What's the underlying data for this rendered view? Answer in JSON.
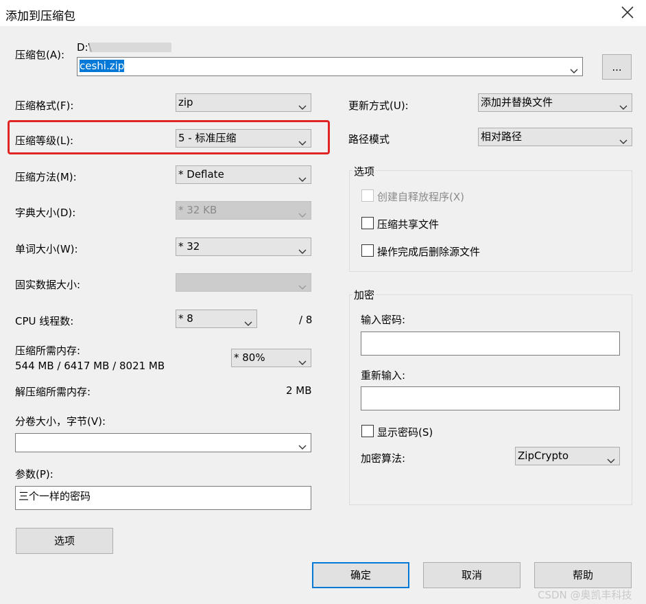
{
  "window": {
    "title": "添加到压缩包",
    "close_icon": "close-icon"
  },
  "archive": {
    "label": "压缩包(A):",
    "path_prefix": "D:\\",
    "filename": "ceshi.zip",
    "browse_label": "..."
  },
  "left": {
    "format": {
      "label": "压缩格式(F):",
      "value": "zip"
    },
    "level": {
      "label": "压缩等级(L):",
      "value": "5 - 标准压缩"
    },
    "method": {
      "label": "压缩方法(M):",
      "value": "*  Deflate"
    },
    "dict": {
      "label": "字典大小(D):",
      "value": "*  32 KB"
    },
    "word": {
      "label": "单词大小(W):",
      "value": "*  32"
    },
    "solid": {
      "label": "固实数据大小:",
      "value": ""
    },
    "cpu": {
      "label": "CPU 线程数:",
      "value": "* 8",
      "max": "/ 8"
    },
    "mem_compress": {
      "label": "压缩所需内存:",
      "value": "544 MB / 6417 MB / 8021 MB",
      "percent": "* 80%"
    },
    "mem_decompress": {
      "label": "解压缩所需内存:",
      "value": "2 MB"
    },
    "volume": {
      "label": "分卷大小，字节(V):",
      "value": ""
    },
    "params": {
      "label": "参数(P):",
      "value": "三个一样的密码"
    },
    "options_button": "选项"
  },
  "right": {
    "update": {
      "label": "更新方式(U):",
      "value": "添加并替换文件"
    },
    "path_mode": {
      "label": "路径模式",
      "value": "相对路径"
    },
    "options_group": {
      "title": "选项",
      "sfx": "创建自释放程序(X)",
      "shared": "压缩共享文件",
      "delete": "操作完成后删除源文件"
    },
    "encrypt_group": {
      "title": "加密",
      "password_label": "输入密码:",
      "reenter_label": "重新输入:",
      "show_password": "显示密码(S)",
      "method_label": "加密算法:",
      "method_value": "ZipCrypto"
    }
  },
  "footer": {
    "ok": "确定",
    "cancel": "取消",
    "help": "帮助"
  },
  "watermark": "CSDN @奥凯丰科技",
  "colors": {
    "highlight_box": "#e02424",
    "selection": "#0078d7",
    "default_button_border": "#0078d7"
  }
}
